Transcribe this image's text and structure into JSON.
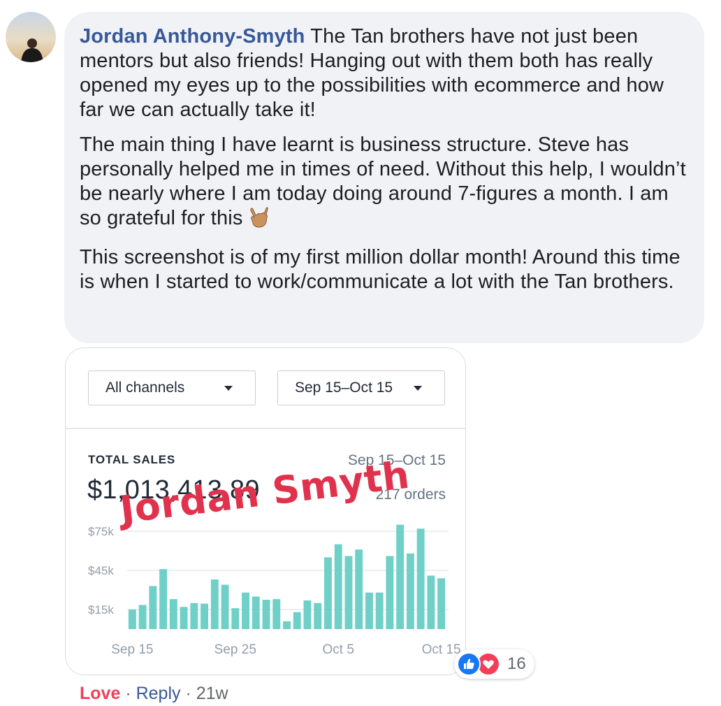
{
  "comment": {
    "author": "Jordan Anthony-Smyth",
    "paragraph1": "The Tan brothers have not just been mentors but also friends! Hanging out with them both has really opened my eyes up to the possibilities with ecommerce and how far we can actually take it!",
    "paragraph2": "The main thing I have learnt is business structure. Steve has personally helped me in times of need. Without this help, I wouldn’t be nearly where I am today doing around 7-figures a month. I am so grateful for this",
    "paragraph2_emoji": "call-me-hand-emoji",
    "paragraph3": "This screenshot is of my first million dollar month! Around this time is when I started to work/communicate a lot with the Tan brothers."
  },
  "screenshot": {
    "channel_filter": "All channels",
    "date_filter": "Sep 15–Oct 15",
    "total_sales_label": "TOTAL SALES",
    "date_range": "Sep 15–Oct 15",
    "total_sales_value": "$1,013,413.89",
    "orders_text": "217 orders",
    "watermark": "Jordan Smyth",
    "bar_color": "#6fd0c7"
  },
  "chart_data": {
    "type": "bar",
    "title": "TOTAL SALES",
    "x_tick_labels": [
      "Sep 15",
      "Sep 25",
      "Oct 5",
      "Oct 15"
    ],
    "x_tick_indices": [
      0,
      10,
      20,
      30
    ],
    "y_tick_labels": [
      "$15k",
      "$45k",
      "$75k"
    ],
    "y_ticks": [
      15000,
      45000,
      75000
    ],
    "ylim": [
      0,
      85000
    ],
    "grid": true,
    "values": [
      15000,
      18500,
      33000,
      46000,
      23000,
      17000,
      20000,
      19500,
      38000,
      34000,
      16000,
      28000,
      25000,
      22500,
      23000,
      6000,
      13000,
      22000,
      20000,
      55000,
      65000,
      56000,
      61000,
      28000,
      28000,
      56000,
      80000,
      58000,
      77000,
      41000,
      39000
    ]
  },
  "reactions": {
    "icons": [
      "like-icon",
      "love-icon"
    ],
    "count": "16",
    "like_color": "#1877f2",
    "love_color": "#f33e58"
  },
  "actions": {
    "love": "Love",
    "separator": "·",
    "reply": "Reply",
    "time": "21w"
  }
}
